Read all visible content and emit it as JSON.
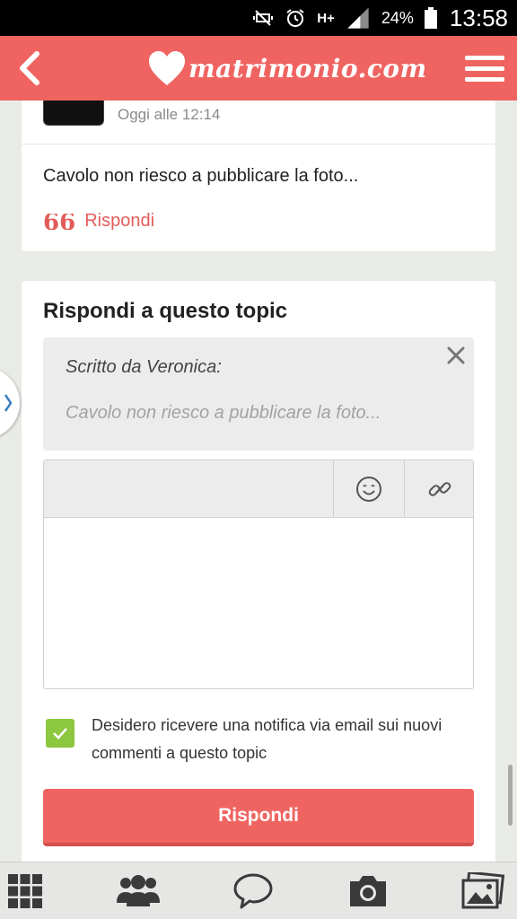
{
  "status_bar": {
    "battery": "24%",
    "time": "13:58",
    "network": "H+",
    "icons": [
      "mute-icon",
      "alarm-icon",
      "network-hplus-icon",
      "signal-icon",
      "battery-icon"
    ]
  },
  "header": {
    "logo_text": "matrimonio.com",
    "back_icon": "chevron-left-icon",
    "menu_icon": "hamburger-menu-icon"
  },
  "comment": {
    "timestamp": "Oggi alle 12:14",
    "text": "Cavolo non riesco a pubblicare la foto...",
    "reply_label": "Rispondi",
    "quote_icon_glyph": "66"
  },
  "reply_form": {
    "title": "Rispondi a questo topic",
    "quote": {
      "author_line": "Scritto da Veronica:",
      "text": "Cavolo non riesco a pubblicare la foto..."
    },
    "toolbar": {
      "emoji_icon": "smiley-icon",
      "link_icon": "link-icon"
    },
    "notify": {
      "checked": true,
      "label": "Desidero ricevere una notifica via email sui nuovi commenti a questo topic"
    },
    "submit_label": "Rispondi"
  },
  "bottom_nav": {
    "items": [
      "grid-icon",
      "community-icon",
      "chat-icon",
      "camera-icon",
      "gallery-icon"
    ]
  },
  "colors": {
    "brand": "#ef6461",
    "accent_text": "#e35b58",
    "checkbox": "#8dc63f",
    "background": "#e9ebe7"
  }
}
